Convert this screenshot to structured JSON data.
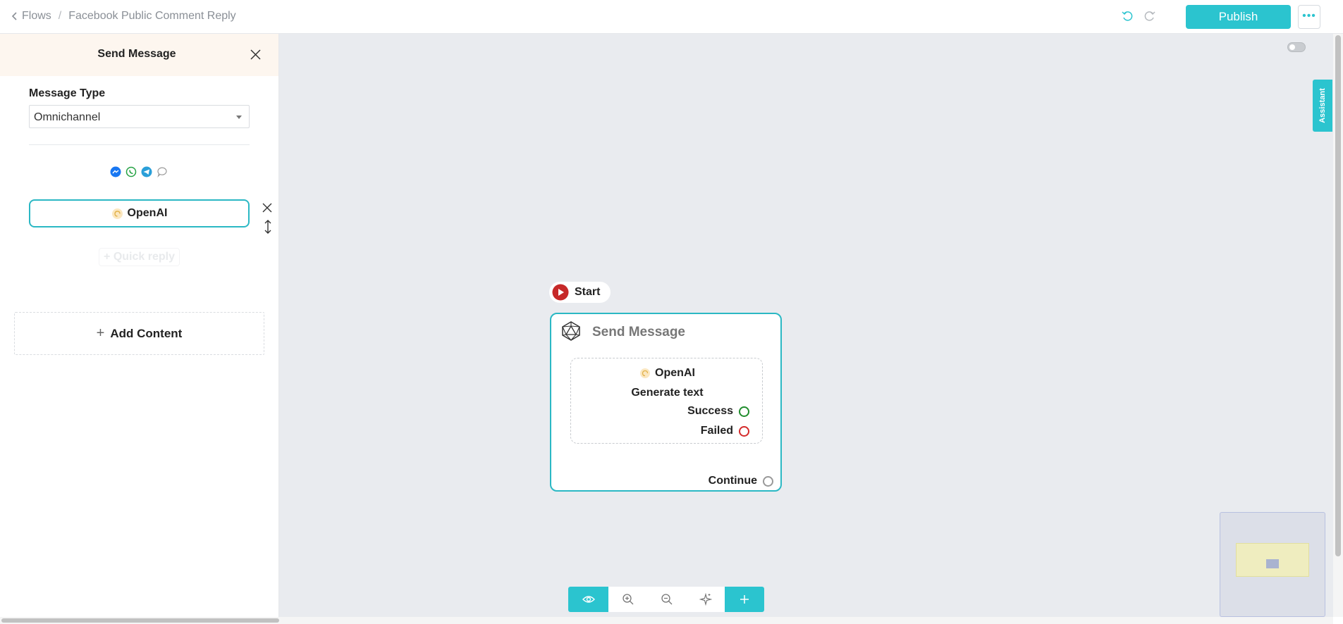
{
  "breadcrumb": {
    "parent": "Flows",
    "separator": "/",
    "current": "Facebook Public Comment Reply"
  },
  "toolbar_top": {
    "publish_label": "Publish",
    "more_label": "•••"
  },
  "panel": {
    "title": "Send Message",
    "message_type_label": "Message Type",
    "message_type_value": "Omnichannel",
    "channel_icons": [
      "messenger-icon",
      "whatsapp-icon",
      "telegram-icon",
      "chat-bubble-icon"
    ],
    "content_item_label": "OpenAI",
    "quick_reply_label": "+ Quick reply",
    "add_content_label": "Add Content"
  },
  "canvas": {
    "assistant_label": "Assistant",
    "start_label": "Start",
    "node": {
      "title": "Send Message",
      "integration_label": "OpenAI",
      "action_label": "Generate text",
      "success_label": "Success",
      "failed_label": "Failed",
      "continue_label": "Continue"
    }
  },
  "colors": {
    "accent": "#2bc4cf",
    "success": "#1f8c2c",
    "failed": "#d42a2a",
    "start": "#d42a2a"
  }
}
